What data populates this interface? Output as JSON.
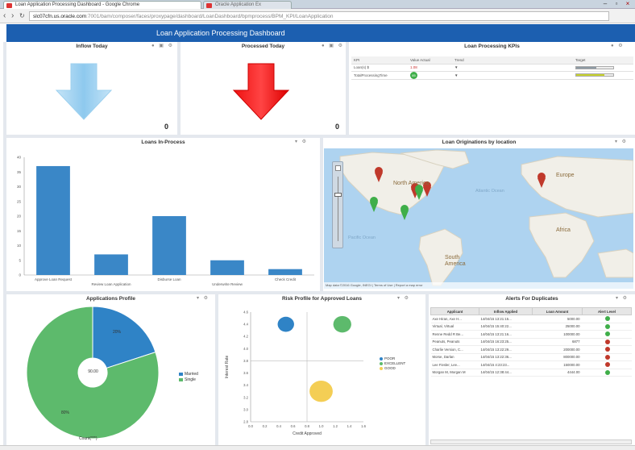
{
  "browser": {
    "tabs": [
      {
        "label": "Loan Application Processing Dashboard - Google Chrome",
        "active": true
      },
      {
        "label": "Oracle Application Ex",
        "active": false
      }
    ],
    "url_host": "slc07cfn.us.oracle.com",
    "url_path": ":7001/bam/composer/faces/proxypage/dashboard/LoanDashboard/bpmprocess/BPM_KPI/LoanApplication"
  },
  "dashboard": {
    "title": "Loan Application Processing Dashboard"
  },
  "inflow": {
    "title": "Inflow Today",
    "value": "0"
  },
  "processed": {
    "title": "Processed Today",
    "value": "0"
  },
  "kpis": {
    "title": "Loan Processing KPIs",
    "headers": [
      "KPI",
      "Value Actual",
      "Trend",
      "",
      "Target"
    ],
    "rows": [
      {
        "name": "Loan(s) $",
        "value": "1.08",
        "trend": "▼",
        "target_fill": 0.55,
        "target_color": "#8d9aa4"
      },
      {
        "name": "TotalProcessingTime",
        "value": "85",
        "trend": "▼",
        "target_fill": 0.75,
        "target_color": "#c8d22b"
      }
    ]
  },
  "loans_in_process": {
    "title": "Loans In-Process",
    "chart_data": {
      "type": "bar",
      "categories": [
        "Approve Loan Request",
        "Review Loan Application",
        "Disburse Loan",
        "Underwrite Review",
        "Check Credit"
      ],
      "values": [
        37,
        7,
        20,
        5,
        2
      ],
      "ylim": [
        0,
        40
      ],
      "yticks": [
        "0",
        "5",
        "10",
        "15",
        "20",
        "25",
        "30",
        "35",
        "40"
      ],
      "color": "#3a87c7"
    }
  },
  "map": {
    "title": "Loan Originations by location",
    "labels": [
      "North America",
      "Europe",
      "Africa",
      "South America",
      "Atlantic Ocean",
      "Pacific Ocean"
    ],
    "attribution": "Map data ©2016 Google, INEGI | Terms of Use | Report a map error"
  },
  "apps_profile": {
    "title": "Applications Profile",
    "chart_data": {
      "type": "pie",
      "slices": [
        {
          "name": "Married",
          "value": 20,
          "color": "#2f83c6"
        },
        {
          "name": "Single",
          "value": 80,
          "color": "#5dba6c"
        }
      ],
      "labels": [
        "20%",
        "80%"
      ],
      "center_label": "90.00",
      "xlabel": "Count(***)"
    }
  },
  "risk_profile": {
    "title": "Risk Profile for Approved Loans",
    "chart_data": {
      "type": "scatter",
      "xlabel": "Credit Approved",
      "ylabel": "Interest Rate",
      "xticks": [
        "0.0",
        "0.2",
        "0.4",
        "0.6",
        "0.8",
        "1.0",
        "1.2",
        "1.4",
        "1.6"
      ],
      "yticks": [
        "2.8",
        "3.0",
        "3.2",
        "3.4",
        "3.6",
        "3.8",
        "4.0",
        "4.2",
        "4.4",
        "4.6"
      ],
      "xlim": [
        0,
        1.6
      ],
      "ylim": [
        2.8,
        4.6
      ],
      "series": [
        {
          "name": "POOR",
          "color": "#2f83c6",
          "x": 0.5,
          "y": 4.4,
          "size": 0.5
        },
        {
          "name": "EXCELLENT",
          "color": "#5dba6c",
          "x": 1.3,
          "y": 4.4,
          "size": 0.6
        },
        {
          "name": "GOOD",
          "color": "#f4ce55",
          "x": 1.0,
          "y": 3.3,
          "size": 1.0
        }
      ]
    }
  },
  "alerts": {
    "title": "Alerts For Duplicates",
    "headers": [
      "Applicant",
      "Inflow Applied",
      "Loan Amount",
      "Alert Level"
    ],
    "rows": [
      [
        "Axe Hiran, Axe H...",
        "14/04/15 13:21:15...",
        "5000.00",
        "#3fae49"
      ],
      [
        "Virtual, Virtual",
        "14/04/15 15:40:22...",
        "25000.00",
        "#3fae49"
      ],
      [
        "Renne Redd R Be...",
        "14/04/15 13:21:16...",
        "100000.00",
        "#3fae49"
      ],
      [
        "Peanuts, Peanuts",
        "14/04/15 16:23:25...",
        "6877",
        "#c0392b"
      ],
      [
        "Charlie Version, C...",
        "14/04/15 13:22:29...",
        "200000.00",
        "#c0392b"
      ],
      [
        "Morse, Darlan",
        "14/04/15 13:22:36...",
        "800000.00",
        "#c0392b"
      ],
      [
        "Lee Fiesler, Lee...",
        "14/04/15 4:23:23...",
        "150000.00",
        "#c0392b"
      ],
      [
        "Morgan M, Morgan M",
        "14/04/15 12:38:44...",
        "4444.00",
        "#3fae49"
      ]
    ]
  }
}
